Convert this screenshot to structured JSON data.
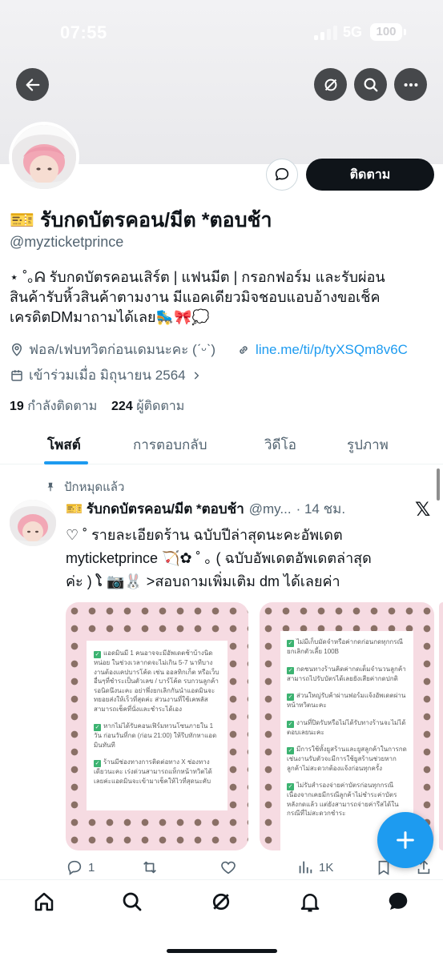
{
  "status_bar": {
    "time": "07:55",
    "network": "5G",
    "battery": "100"
  },
  "profile": {
    "display_name": "🎫 รับกดบัตรคอน/มีต *ตอบช้า",
    "handle": "@myzticketprince",
    "follow_label": "ติดตาม",
    "bio_lines": [
      "⋆ ˚｡ᕱ รับกดบัตรคอนเสิร์ต | แฟนมีต | กรอกฟอร์ม และรับผ่อน",
      "สินค้ารับหิ้วสินค้าตามงาน มีแอคเดียวมิจชอบแอบอ้างขอเช็ค",
      "เครดิตDMมาถามได้เลย🛼🎀💭"
    ],
    "location": "ฟอล/เฟบทวิตก่อนเดมนะคะ (ˊᵕˋ)",
    "link": "line.me/ti/p/tyXSQm8v6C",
    "joined": "เข้าร่วมเมื่อ มิถุนายน 2564",
    "following_count": "19",
    "following_label": "กำลังติดตาม",
    "followers_count": "224",
    "followers_label": "ผู้ติดตาม"
  },
  "tabs": [
    "โพสต์",
    "การตอบกลับ",
    "วิดีโอ",
    "รูปภาพ"
  ],
  "post": {
    "pinned_label": "ปักหมุดแล้ว",
    "author_name": "🎫 รับกดบัตรคอน/มีต *ตอบช้า",
    "author_handle": "@my...",
    "time": "· 14 ชม.",
    "text_lines": [
      "♡ ˚ รายละเอียดร้าน ฉบับปีล่าสุดนะคะอัพเดต",
      "myticketprince 🏹✿ ˚ ｡     ( ฉบับอัพเดตอัพเดตล่าสุด",
      "ค่ะ ) ໂ 📷🐰 >สอบถามเพิ่มเติม dm ได้เลยค่า"
    ],
    "media_left_items": [
      "แอดมินมี 1 คนอาจจะมีอัพเดตช้าบ้างนิดหน่อย ในช่วงเวลากดจะไม่เกิน 5-7 นาทีบางงานต้องแคปบารโค้ด เช่น ออลทิกเก็ต หรือเว็บอื่นๆที่ชำระเป็นตัวเลข / บาร์โค้ด รบกวนลูกค้ารอนิดนึงนะคะ อย่าพึ่งยกเลิกกันนำแอดมินจะทยอยส่งให้เร็วที่สุดค่ะ ส่วนงานที่ใช้เคพลัสสามารถเช็คที่นั่งและชำระได้เอง",
      "หากไม่ได้รับคอนเฟิร์มทวนโซนภายใน 1 วัน ก่อนวันที่กด (ก่อน 21:00) ให้รีบทักหาแอดมินทันที",
      "ร้านมีช่องทางการติดต่อทาง X ช่องทางเดียวนะคะ เร่งด่วนสามารถแท็กหน้าทวิตได้เลยค่ะแอดมินจะเข้ามาเช็คให้ไวที่สุดนะคับ"
    ],
    "media_right_items": [
      "ไม่มีเก็บมัดจำหรือค่ากดก่อนกดทุกกรณียกเลิกตัวเลี้ย 100B",
      "กดชนทางร้านคิดค่ากดเต็มจำนวนลูกค้าสามารถไปรับบัตรได้เลยยังเสียค่ากดปกติ",
      "ส่วนใหญ่รับค้าผ่านฟอร์มแจ้งอัพเดตผ่านหน้าทวิตนะคะ",
      "งานที่ปิดรับหรือไม่ได้รับทางร้านจะไม่ได้ตอบเลยนะคะ",
      "มีการใช้ทั้งยูสร้านและยูสลูกค้าในการกด เช่นงานรับตัวจะมีการใช้ยูสร้านช่วยหากลูกค้าไม่สะดวกต้องแจ้งก่อนทุกครั้ง",
      "ไม่รับสำรองจ่ายค่าบัตรก่อนทุกกรณีเนื่องจากเคยมีกรณีลูกค้าไม่ชำระค่าบัตรหลังกดแล้ว แต่ยังสามารถจ่ายค่ารีสได้ในกรณีที่ไม่สะดวกชำระ"
    ],
    "replies": "1",
    "views": "1K"
  },
  "colors": {
    "accent": "#1d9bf0",
    "text": "#0f1419",
    "secondary": "#536471"
  }
}
